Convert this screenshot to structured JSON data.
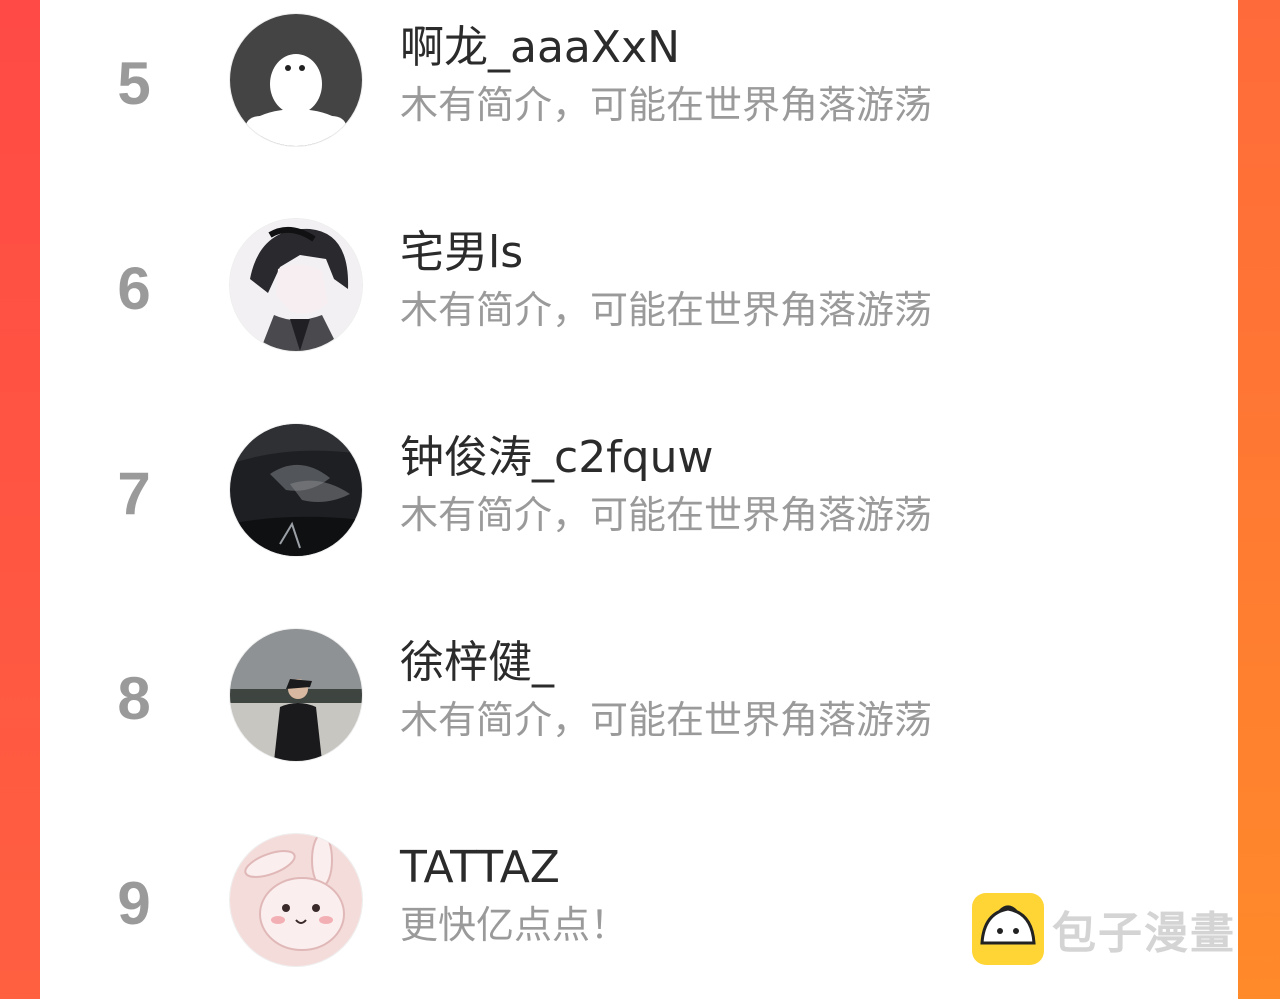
{
  "ranking": [
    {
      "rank": "5",
      "name": "啊龙_aaaXxN",
      "bio": "木有简介，可能在世界角落游荡",
      "avatar_icon": "ghost-avatar-icon"
    },
    {
      "rank": "6",
      "name": "宅男ls",
      "bio": "木有简介，可能在世界角落游荡",
      "avatar_icon": "anime-boy-avatar-icon"
    },
    {
      "rank": "7",
      "name": "钟俊涛_c2fquw",
      "bio": "木有简介，可能在世界角落游荡",
      "avatar_icon": "dark-landscape-avatar-icon"
    },
    {
      "rank": "8",
      "name": "徐梓健_",
      "bio": "木有简介，可能在世界角落游荡",
      "avatar_icon": "person-photo-avatar-icon"
    },
    {
      "rank": "9",
      "name": "TATTAZ",
      "bio": "更快亿点点！",
      "avatar_icon": "bunny-avatar-icon"
    }
  ],
  "watermark": {
    "text": "包子漫畫",
    "icon": "bun-logo-icon"
  },
  "colors": {
    "accent_left": "#ff4a45",
    "accent_right": "#ff8a2a",
    "rank_gray": "#9a9a9a",
    "bio_gray": "#9a9a9a",
    "name_dark": "#2b2b2b"
  }
}
